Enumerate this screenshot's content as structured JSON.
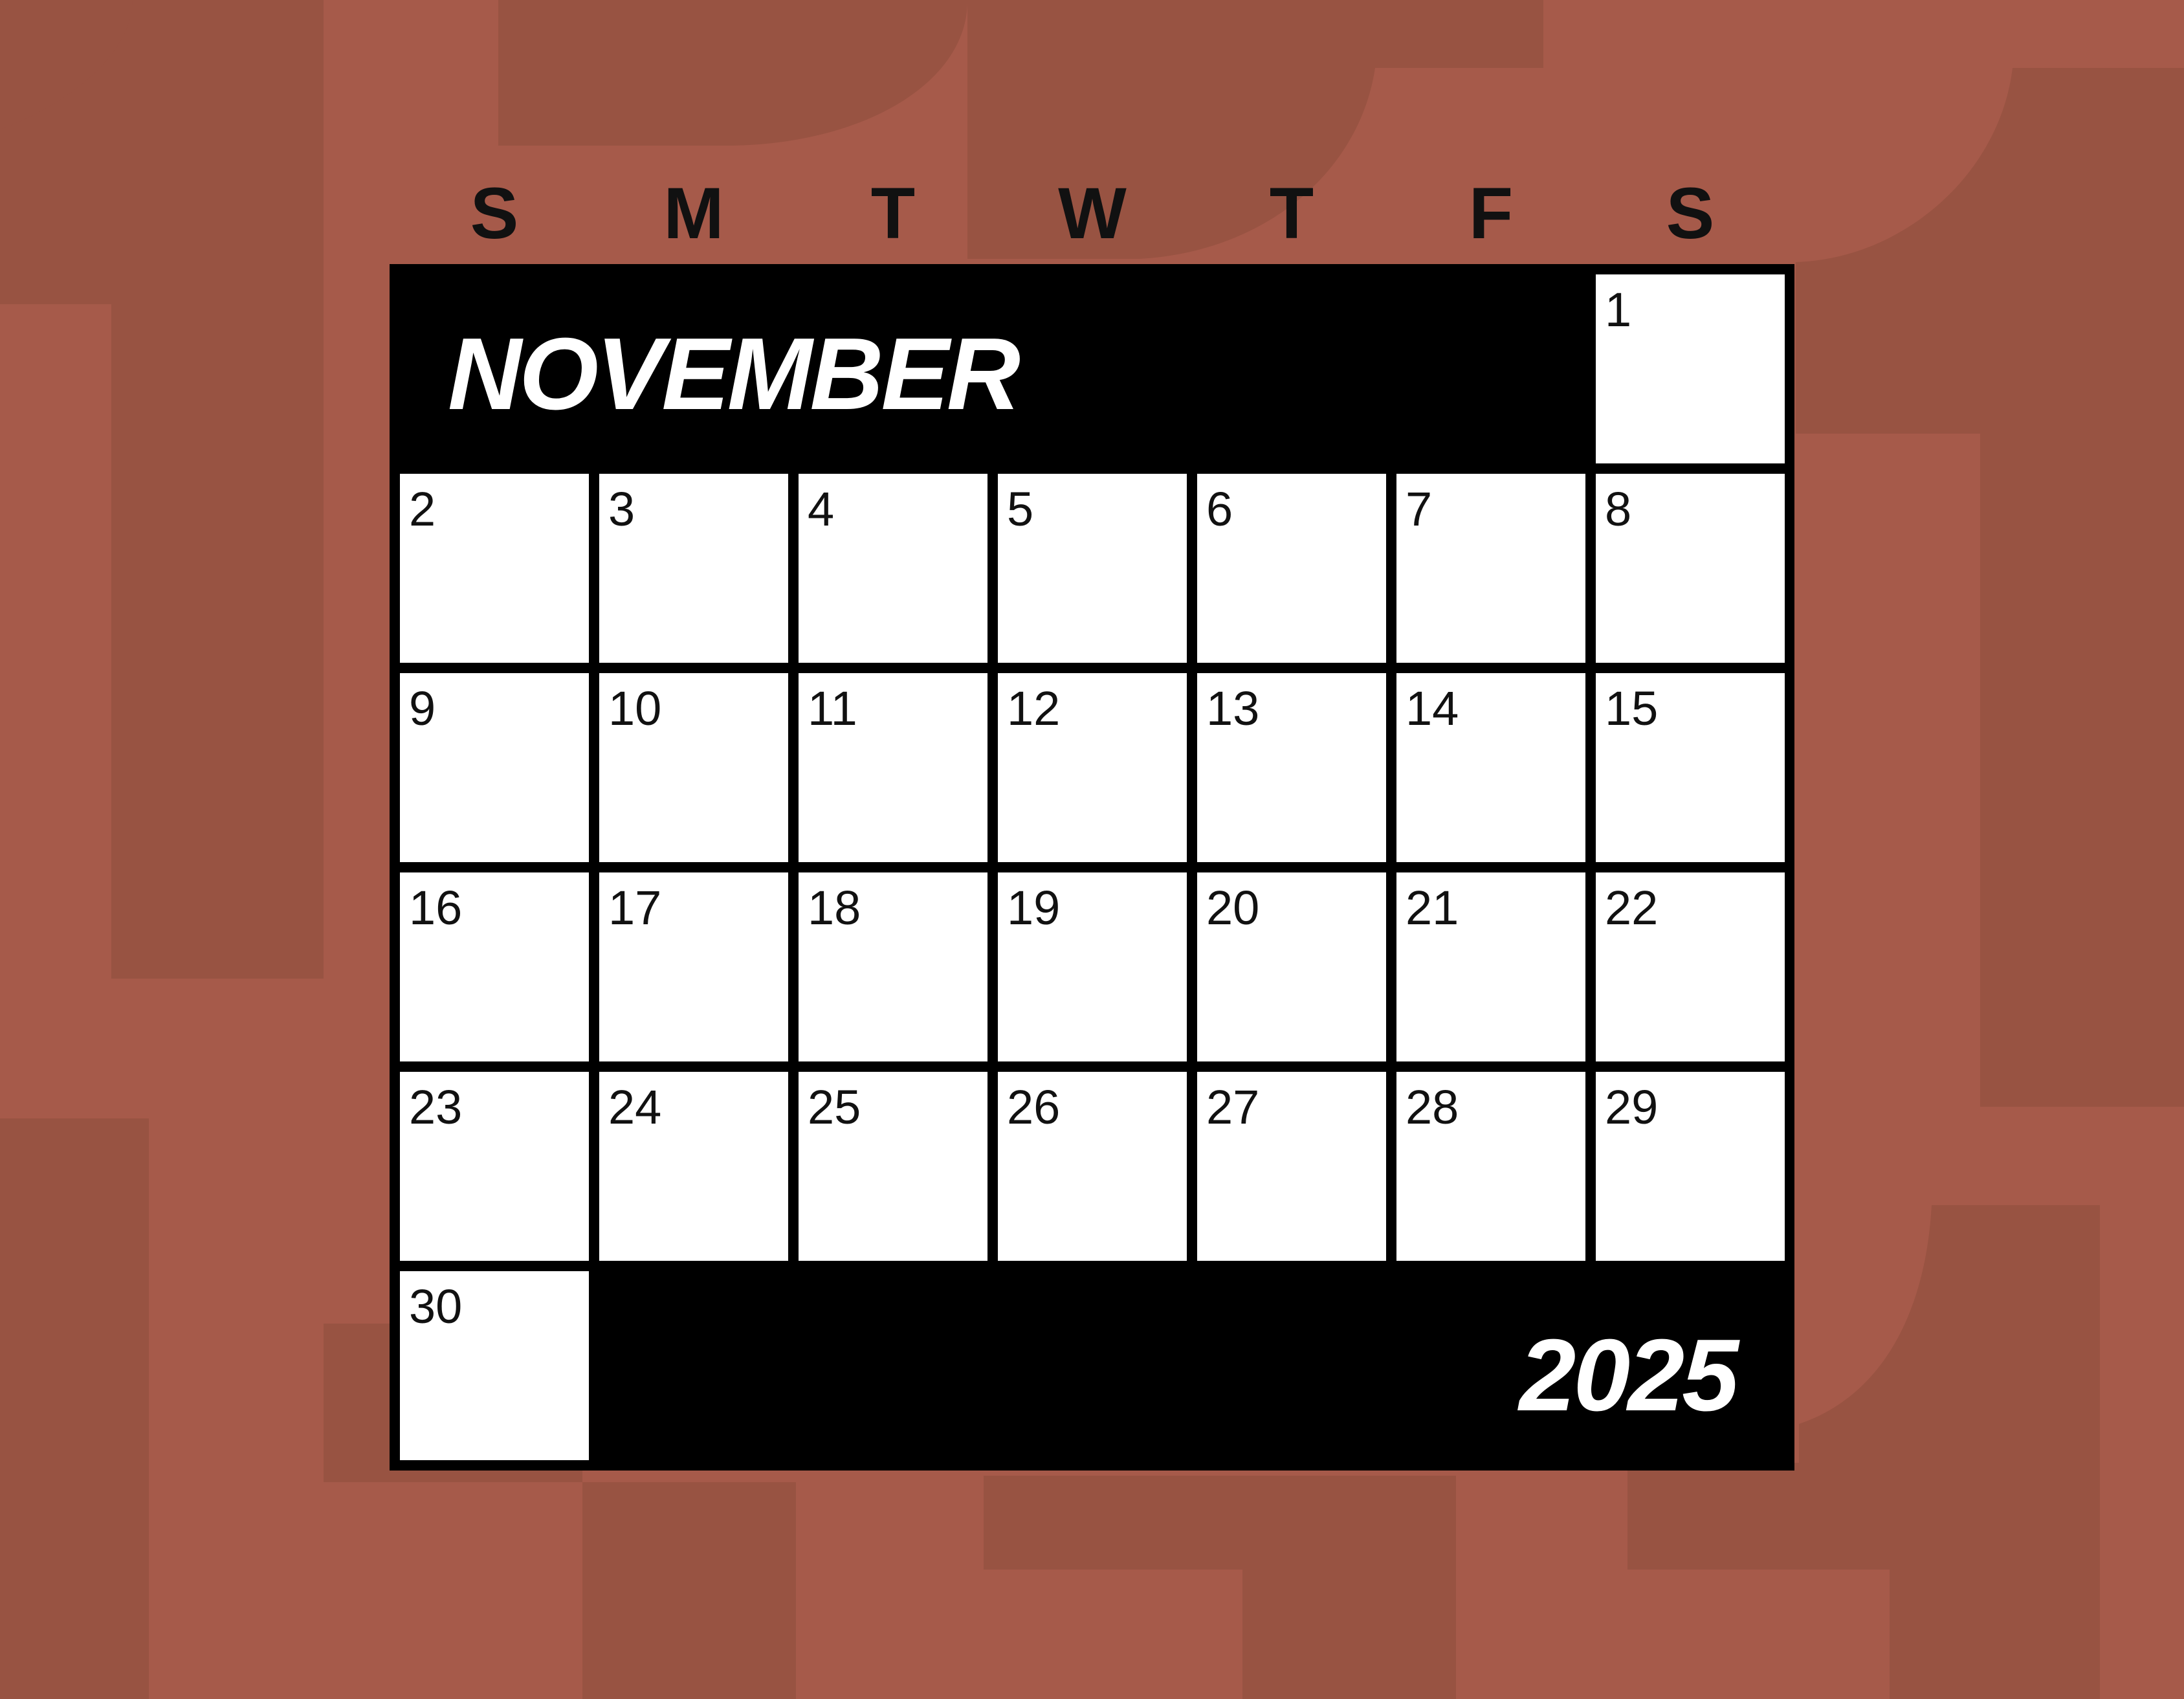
{
  "calendar": {
    "month": "NOVEMBER",
    "year": "2025",
    "weekdays": [
      "S",
      "M",
      "T",
      "W",
      "T",
      "F",
      "S"
    ],
    "first_weekday_index": 6,
    "days": [
      "1",
      "2",
      "3",
      "4",
      "5",
      "6",
      "7",
      "8",
      "9",
      "10",
      "11",
      "12",
      "13",
      "14",
      "15",
      "16",
      "17",
      "18",
      "19",
      "20",
      "21",
      "22",
      "23",
      "24",
      "25",
      "26",
      "27",
      "28",
      "29",
      "30"
    ]
  },
  "colors": {
    "background": "#a65a4a",
    "background_shapes": "#985342",
    "slab": "#000000",
    "cell": "#ffffff"
  }
}
